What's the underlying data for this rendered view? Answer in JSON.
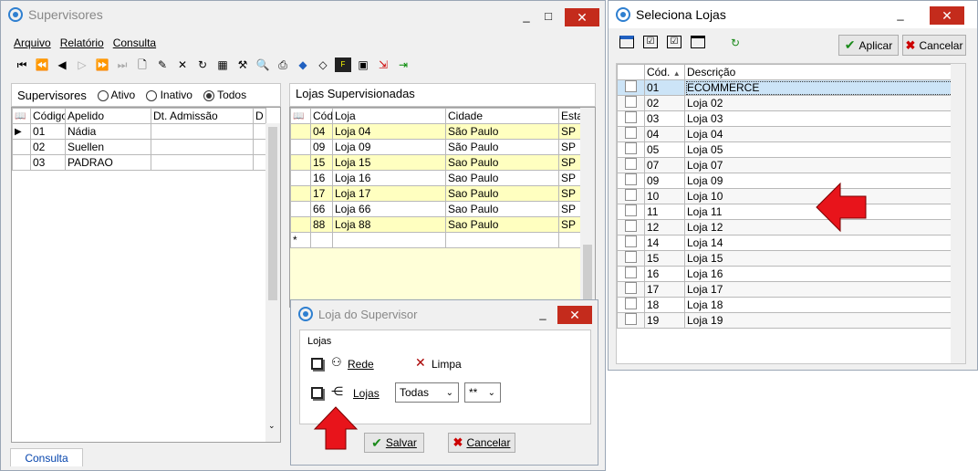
{
  "supervisores": {
    "title": "Supervisores",
    "menu": [
      "Arquivo",
      "Relatório",
      "Consulta"
    ],
    "filter_label": "Supervisores",
    "radios": [
      {
        "label": "Ativo",
        "selected": false
      },
      {
        "label": "Inativo",
        "selected": false
      },
      {
        "label": "Todos",
        "selected": true
      }
    ],
    "columns": [
      "Código",
      "Apelido",
      "Dt. Admissão",
      "D"
    ],
    "rows": [
      {
        "codigo": "01",
        "apelido": "Nádia"
      },
      {
        "codigo": "02",
        "apelido": "Suellen"
      },
      {
        "codigo": "03",
        "apelido": "PADRAO"
      }
    ],
    "lojas_title": "Lojas Supervisionadas",
    "lojas_columns": [
      "Cód",
      "Loja",
      "Cidade",
      "Esta"
    ],
    "lojas_rows": [
      {
        "cod": "04",
        "loja": "Loja 04",
        "cidade": "São Paulo",
        "uf": "SP",
        "highlight": true
      },
      {
        "cod": "09",
        "loja": "Loja 09",
        "cidade": "São Paulo",
        "uf": "SP",
        "highlight": false
      },
      {
        "cod": "15",
        "loja": "Loja 15",
        "cidade": "Sao Paulo",
        "uf": "SP",
        "highlight": true
      },
      {
        "cod": "16",
        "loja": "Loja 16",
        "cidade": "Sao Paulo",
        "uf": "SP",
        "highlight": false
      },
      {
        "cod": "17",
        "loja": "Loja 17",
        "cidade": "Sao Paulo",
        "uf": "SP",
        "highlight": true
      },
      {
        "cod": "66",
        "loja": "Loja 66",
        "cidade": "Sao Paulo",
        "uf": "SP",
        "highlight": false
      },
      {
        "cod": "88",
        "loja": "Loja 88",
        "cidade": "Sao Paulo",
        "uf": "SP",
        "highlight": true
      }
    ],
    "new_row_marker": "*",
    "status_tab": "Consulta"
  },
  "loja_supervisor": {
    "title": "Loja do Supervisor",
    "group_label": "Lojas",
    "rede_label": "Rede",
    "limpa_label": "Limpa",
    "lojas_label": "Lojas",
    "select1": "Todas",
    "select2": "**",
    "salvar": "Salvar",
    "cancelar": "Cancelar"
  },
  "seleciona_lojas": {
    "title": "Seleciona Lojas",
    "aplicar": "Aplicar",
    "cancelar": "Cancelar",
    "columns": [
      "Cód.",
      "Descrição"
    ],
    "rows": [
      {
        "cod": "01",
        "desc": "ECOMMERCE"
      },
      {
        "cod": "02",
        "desc": "Loja 02"
      },
      {
        "cod": "03",
        "desc": "Loja 03"
      },
      {
        "cod": "04",
        "desc": "Loja 04"
      },
      {
        "cod": "05",
        "desc": "Loja 05"
      },
      {
        "cod": "07",
        "desc": "Loja 07"
      },
      {
        "cod": "09",
        "desc": "Loja 09"
      },
      {
        "cod": "10",
        "desc": "Loja 10"
      },
      {
        "cod": "11",
        "desc": "Loja 11"
      },
      {
        "cod": "12",
        "desc": "Loja 12"
      },
      {
        "cod": "14",
        "desc": "Loja 14"
      },
      {
        "cod": "15",
        "desc": "Loja 15"
      },
      {
        "cod": "16",
        "desc": "Loja 16"
      },
      {
        "cod": "17",
        "desc": "Loja 17"
      },
      {
        "cod": "18",
        "desc": "Loja 18"
      },
      {
        "cod": "19",
        "desc": "Loja 19"
      }
    ]
  },
  "colors": {
    "highlight_row": "#ffffc0",
    "close": "#c42b1c",
    "arrow": "#e8141b",
    "selected_row": "#cce4f7"
  }
}
